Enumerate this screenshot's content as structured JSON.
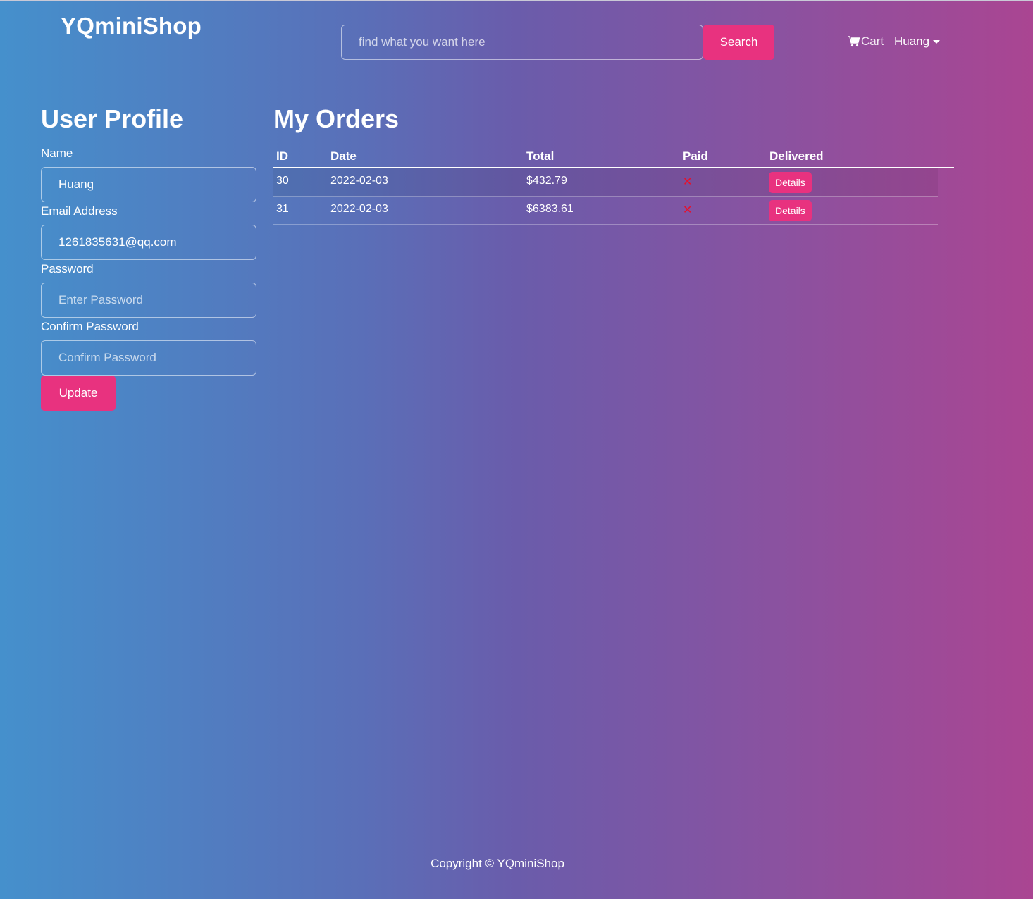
{
  "header": {
    "brand": "YQminiShop",
    "search_placeholder": "find what you want here",
    "search_button": "Search",
    "cart_label": "Cart",
    "user_name": "Huang"
  },
  "profile": {
    "title": "User Profile",
    "name_label": "Name",
    "name_value": "Huang",
    "email_label": "Email Address",
    "email_value": "1261835631@qq.com",
    "password_label": "Password",
    "password_placeholder": "Enter Password",
    "confirm_label": "Confirm Password",
    "confirm_placeholder": "Confirm Password",
    "update_button": "Update"
  },
  "orders": {
    "title": "My Orders",
    "columns": [
      "ID",
      "Date",
      "Total",
      "Paid",
      "Delivered"
    ],
    "rows": [
      {
        "id": "30",
        "date": "2022-02-03",
        "total": "$432.79",
        "paid": "✕",
        "action": "Details"
      },
      {
        "id": "31",
        "date": "2022-02-03",
        "total": "$6383.61",
        "paid": "✕",
        "action": "Details"
      }
    ]
  },
  "footer": {
    "copyright": "Copyright © YQminiShop"
  },
  "colors": {
    "accent": "#e8327f",
    "unpaid_mark": "#e8102a"
  }
}
